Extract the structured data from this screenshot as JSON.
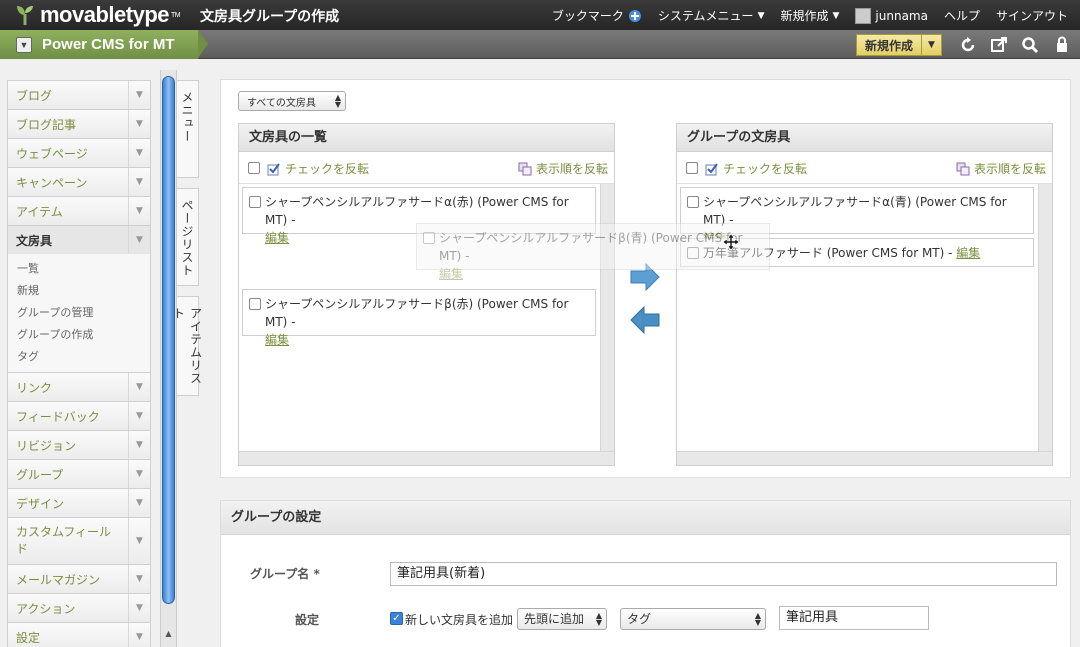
{
  "app": {
    "logo_text": "movabletype",
    "logo_tm": "TM",
    "page_title": "文房具グループの作成"
  },
  "topnav": {
    "bookmark": "ブックマーク",
    "system_menu": "システムメニュー",
    "create_new": "新規作成",
    "username": "junnama",
    "help": "ヘルプ",
    "sign_out": "サインアウト"
  },
  "sitebar": {
    "site_name": "Power CMS for MT",
    "new_button": "新規作成"
  },
  "sidebar": {
    "items": [
      {
        "label": "ブログ"
      },
      {
        "label": "ブログ記事"
      },
      {
        "label": "ウェブページ"
      },
      {
        "label": "キャンペーン"
      },
      {
        "label": "アイテム"
      },
      {
        "label": "文房具"
      }
    ],
    "sub_items": [
      {
        "label": "一覧"
      },
      {
        "label": "新規"
      },
      {
        "label": "グループの管理"
      },
      {
        "label": "グループの作成"
      },
      {
        "label": "タグ"
      }
    ],
    "items_after": [
      {
        "label": "リンク"
      },
      {
        "label": "フィードバック"
      },
      {
        "label": "リビジョン"
      },
      {
        "label": "グループ"
      },
      {
        "label": "デザイン"
      },
      {
        "label": "カスタムフィールド"
      },
      {
        "label": "メールマガジン"
      },
      {
        "label": "アクション"
      },
      {
        "label": "設定"
      }
    ]
  },
  "vertical_tabs": {
    "menu": "メニュー",
    "page_list": "ページリスト",
    "item_list": "アイテムリスト"
  },
  "filter": {
    "selected": "すべての文房具"
  },
  "left_list": {
    "title": "文房具の一覧",
    "toggle_check": "チェックを反転",
    "reverse_order": "表示順を反転",
    "items": [
      {
        "text": "シャープペンシルアルファサードα(赤) (Power CMS for MT) -",
        "edit": "編集"
      },
      {
        "text": "シャープペンシルアルファサードβ(赤) (Power CMS for MT) -",
        "edit": "編集"
      }
    ]
  },
  "dragging_item": {
    "text": "シャープペンシルアルファサードβ(青) (Power CMS for MT) -",
    "edit": "編集"
  },
  "right_list": {
    "title": "グループの文房具",
    "toggle_check": "チェックを反転",
    "reverse_order": "表示順を反転",
    "items": [
      {
        "text": "シャープペンシルアルファサードα(青) (Power CMS for MT) -",
        "edit": "編集"
      },
      {
        "text": "万年筆アルファサード (Power CMS for MT) -",
        "edit": "編集"
      }
    ]
  },
  "settings": {
    "title": "グループの設定",
    "group_name_label": "グループ名 *",
    "group_name_value": "筆記用具(新着)",
    "config_label": "設定",
    "add_new_label": "新しい文房具を追加",
    "add_new_checked": true,
    "position_select": "先頭に追加",
    "tag_select": "タグ",
    "tag_value": "筆記用具"
  },
  "colors": {
    "accent_green": "#7a8f3f",
    "site_green": "#6f8f43",
    "topbar_dark": "#262626"
  }
}
